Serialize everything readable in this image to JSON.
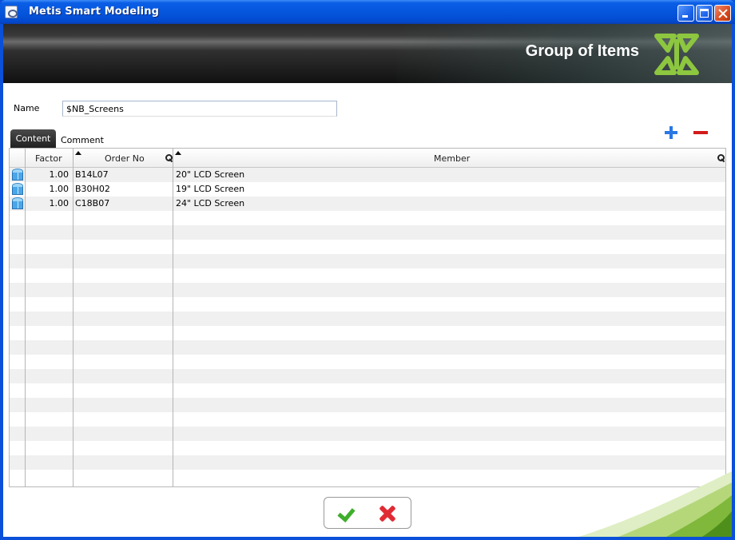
{
  "window": {
    "title": "Metis Smart Modeling"
  },
  "banner": {
    "title": "Group of Items",
    "accent_color": "#8dc63f"
  },
  "form": {
    "name_label": "Name",
    "name_value": "$NB_Screens"
  },
  "tabs": [
    {
      "label": "Content",
      "active": true
    },
    {
      "label": "Comment",
      "active": false
    }
  ],
  "toolbar": {
    "add_icon": "plus-icon",
    "remove_icon": "minus-icon"
  },
  "grid": {
    "columns": [
      "Factor",
      "Order No",
      "Member"
    ],
    "rows": [
      {
        "factor": "1.00",
        "order_no": "B14L07",
        "member": "20\" LCD Screen"
      },
      {
        "factor": "1.00",
        "order_no": "B30H02",
        "member": "19\" LCD Screen"
      },
      {
        "factor": "1.00",
        "order_no": "C18B07",
        "member": "24\" LCD Screen"
      }
    ],
    "empty_rows": 19
  },
  "actions": {
    "ok_icon": "checkmark-icon",
    "cancel_icon": "cross-icon"
  }
}
